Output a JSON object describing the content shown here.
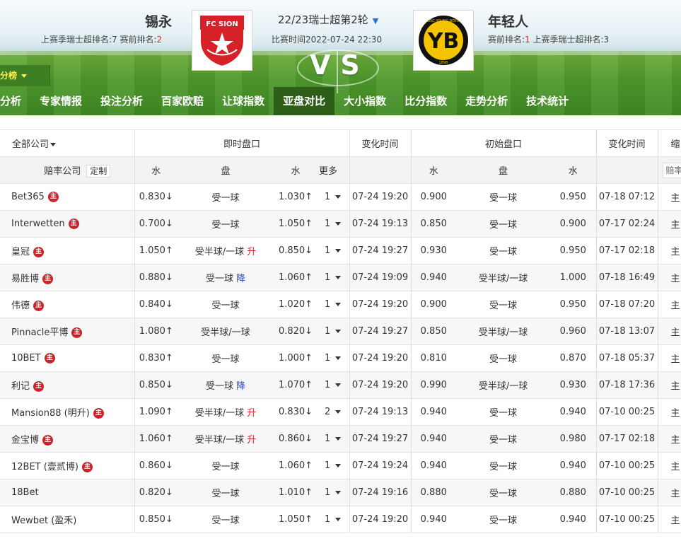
{
  "match": {
    "home_team": "锡永",
    "away_team": "年轻人",
    "home_rank_prefix": "上赛季瑞士超排名:7  赛前排名:",
    "home_rank_current": "2",
    "away_rank_prefix": "赛前排名:",
    "away_rank_current": "1",
    "away_rank_suffix": "  上赛季瑞士超排名:3",
    "round_title": "22/23瑞士超第2轮",
    "match_time": "比赛时间2022-07-24 22:30",
    "vs_text": "VS",
    "home_logo_text": "FC SION",
    "away_logo_text": "YB",
    "away_logo_top": "BSC YOUNG BOYS",
    "away_logo_year": "1898"
  },
  "subtab": {
    "label": "分榜"
  },
  "nav": [
    {
      "label": "分析",
      "active": false
    },
    {
      "label": "专家情报",
      "active": false
    },
    {
      "label": "投注分析",
      "active": false
    },
    {
      "label": "百家欧赔",
      "active": false
    },
    {
      "label": "让球指数",
      "active": false
    },
    {
      "label": "亚盘对比",
      "active": true
    },
    {
      "label": "大小指数",
      "active": false
    },
    {
      "label": "比分指数",
      "active": false
    },
    {
      "label": "走势分析",
      "active": false
    },
    {
      "label": "技术统计",
      "active": false
    }
  ],
  "table": {
    "header1": {
      "company_filter": "全部公司",
      "live_odds": "即时盘口",
      "change_time": "变化时间",
      "initial_odds": "初始盘口",
      "change_time2": "变化时间",
      "last_col": "缩"
    },
    "header2": {
      "odds_company": "赔率公司",
      "customize": "定制",
      "water1": "水",
      "handicap": "盘",
      "water2": "水",
      "more": "更多",
      "init_water1": "水",
      "init_handicap": "盘",
      "init_water2": "水",
      "peilv_btn": "赔率"
    },
    "zhu_label": "主",
    "last_cell_text": "主",
    "rows": [
      {
        "company": "Bet365",
        "w1": "0.830↓",
        "w1_dir": "down",
        "hcp": "受一球",
        "hcp_tag": "",
        "w2": "1.030↑",
        "w2_dir": "up",
        "more": "1",
        "time": "07-24 19:20",
        "iw1": "0.900",
        "ihcp": "受一球",
        "iw2": "0.950",
        "itime": "07-18 07:12"
      },
      {
        "company": "Interwetten",
        "w1": "0.700↓",
        "w1_dir": "down",
        "hcp": "受一球",
        "hcp_tag": "",
        "w2": "1.050↑",
        "w2_dir": "up",
        "more": "1",
        "time": "07-24 19:13",
        "iw1": "0.850",
        "ihcp": "受一球",
        "iw2": "0.900",
        "itime": "07-17 02:24"
      },
      {
        "company": "皇冠",
        "w1": "1.050↑",
        "w1_dir": "up",
        "hcp": "受半球/一球",
        "hcp_tag": "升",
        "w2": "0.850↓",
        "w2_dir": "down",
        "more": "1",
        "time": "07-24 19:27",
        "iw1": "0.930",
        "ihcp": "受一球",
        "iw2": "0.950",
        "itime": "07-17 02:18"
      },
      {
        "company": "易胜博",
        "w1": "0.880↓",
        "w1_dir": "down",
        "hcp": "受一球",
        "hcp_tag": "降",
        "w2": "1.060↑",
        "w2_dir": "up",
        "more": "1",
        "time": "07-24 19:09",
        "iw1": "0.940",
        "ihcp": "受半球/一球",
        "iw2": "1.000",
        "itime": "07-18 16:49"
      },
      {
        "company": "伟德",
        "w1": "0.840↓",
        "w1_dir": "down",
        "hcp": "受一球",
        "hcp_tag": "",
        "w2": "1.020↑",
        "w2_dir": "up",
        "more": "1",
        "time": "07-24 19:20",
        "iw1": "0.900",
        "ihcp": "受一球",
        "iw2": "0.950",
        "itime": "07-18 07:20"
      },
      {
        "company": "Pinnacle平博",
        "w1": "1.080↑",
        "w1_dir": "up",
        "hcp": "受半球/一球",
        "hcp_tag": "",
        "w2": "0.820↓",
        "w2_dir": "down",
        "more": "1",
        "time": "07-24 19:27",
        "iw1": "0.850",
        "ihcp": "受半球/一球",
        "iw2": "0.960",
        "itime": "07-18 13:07"
      },
      {
        "company": "10BET",
        "w1": "0.830↑",
        "w1_dir": "up",
        "hcp": "受一球",
        "hcp_tag": "",
        "w2": "1.000↑",
        "w2_dir": "up",
        "more": "1",
        "time": "07-24 19:20",
        "iw1": "0.810",
        "ihcp": "受一球",
        "iw2": "0.870",
        "itime": "07-18 05:37"
      },
      {
        "company": "利记",
        "w1": "0.850↓",
        "w1_dir": "down",
        "hcp": "受一球",
        "hcp_tag": "降",
        "w2": "1.070↑",
        "w2_dir": "up",
        "more": "1",
        "time": "07-24 19:20",
        "iw1": "0.990",
        "ihcp": "受半球/一球",
        "iw2": "0.930",
        "itime": "07-18 17:36"
      },
      {
        "company": "Mansion88 (明升)",
        "w1": "1.090↑",
        "w1_dir": "up",
        "hcp": "受半球/一球",
        "hcp_tag": "升",
        "w2": "0.830↓",
        "w2_dir": "down",
        "more": "2",
        "time": "07-24 19:13",
        "iw1": "0.940",
        "ihcp": "受一球",
        "iw2": "0.940",
        "itime": "07-10 00:25"
      },
      {
        "company": "金宝博",
        "w1": "1.060↑",
        "w1_dir": "up",
        "hcp": "受半球/一球",
        "hcp_tag": "升",
        "w2": "0.860↓",
        "w2_dir": "down",
        "more": "1",
        "time": "07-24 19:27",
        "iw1": "0.940",
        "ihcp": "受一球",
        "iw2": "0.980",
        "itime": "07-17 02:18"
      },
      {
        "company": "12BET (壹贰博)",
        "w1": "0.860↓",
        "w1_dir": "down",
        "hcp": "受一球",
        "hcp_tag": "",
        "w2": "1.060↑",
        "w2_dir": "up",
        "more": "1",
        "time": "07-24 19:24",
        "iw1": "0.940",
        "ihcp": "受一球",
        "iw2": "0.940",
        "itime": "07-10 00:25"
      },
      {
        "company": "18Bet",
        "w1": "0.820↓",
        "w1_dir": "down",
        "hcp": "受一球",
        "hcp_tag": "",
        "w2": "1.010↑",
        "w2_dir": "up",
        "more": "1",
        "time": "07-24 19:16",
        "iw1": "0.880",
        "ihcp": "受一球",
        "iw2": "0.880",
        "itime": "07-10 00:25"
      },
      {
        "company": "Wewbet (盈禾)",
        "w1": "0.850↓",
        "w1_dir": "down",
        "hcp": "受一球",
        "hcp_tag": "",
        "w2": "1.050↑",
        "w2_dir": "up",
        "more": "1",
        "time": "07-24 19:20",
        "iw1": "0.940",
        "ihcp": "受一球",
        "iw2": "0.940",
        "itime": "07-10 00:25"
      }
    ],
    "row_zhu": [
      true,
      true,
      true,
      true,
      true,
      true,
      true,
      true,
      true,
      true,
      true,
      false,
      false
    ]
  },
  "colors": {
    "up": "#e02020",
    "down": "#2f9a2f",
    "tag_down": "#2a4fc8",
    "nav_active": "#2d5e17",
    "zhu_badge": "#c8242a"
  }
}
